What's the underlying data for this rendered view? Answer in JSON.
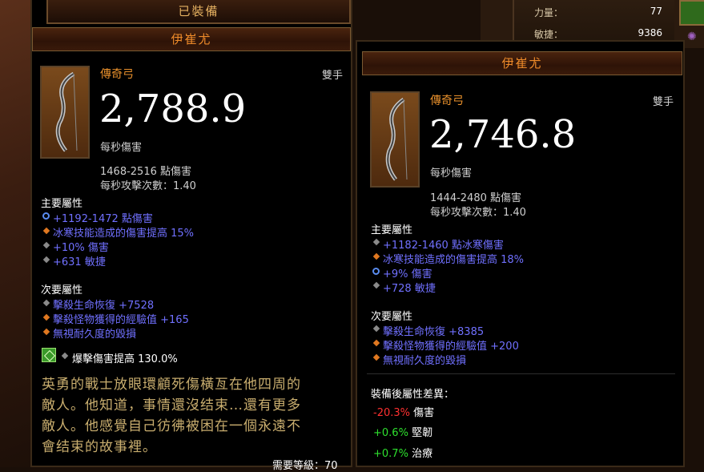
{
  "stats_panel": {
    "strength_label": "力量：",
    "strength_value": "77",
    "dexterity_label": "敏捷：",
    "dexterity_value": "9386"
  },
  "equipped_header": "已裝備",
  "left_item": {
    "name": "伊崔尤",
    "type": "傳奇弓",
    "hand": "雙手",
    "dps": "2,788.9",
    "dps_label": "每秒傷害",
    "damage_range": "1468-2516 點傷害",
    "attack_speed": "每秒攻擊次數：1.40",
    "primary_header": "主要屬性",
    "primary": [
      "+1192-1472 點傷害",
      "冰寒技能造成的傷害提高 15%",
      "+10% 傷害",
      "+631 敏捷"
    ],
    "secondary_header": "次要屬性",
    "secondary": [
      "擊殺生命恢復 +7528",
      "擊殺怪物獲得的經驗值 +165",
      "無視耐久度的毀損"
    ],
    "socket": "爆擊傷害提高 130.0%",
    "flavor": [
      "英勇的戰士放眼環顧死傷橫亙在他四周的",
      "敵人。他知道，事情還沒结束…還有更多",
      "敵人。他感覺自己彷彿被困在一個永遠不",
      "會结束的故事裡。"
    ],
    "required_level": "需要等級：70"
  },
  "right_item": {
    "name": "伊崔尤",
    "type": "傳奇弓",
    "hand": "雙手",
    "dps": "2,746.8",
    "dps_label": "每秒傷害",
    "damage_range": "1444-2480 點傷害",
    "attack_speed": "每秒攻擊次數：1.40",
    "primary_header": "主要屬性",
    "primary": [
      "+1182-1460 點冰寒傷害",
      "冰寒技能造成的傷害提高 18%",
      "+9% 傷害",
      "+728 敏捷"
    ],
    "secondary_header": "次要屬性",
    "secondary": [
      "擊殺生命恢復 +8385",
      "擊殺怪物獲得的經驗值 +200",
      "無視耐久度的毀損"
    ],
    "diff_header": "裝備後屬性差異：",
    "diffs": [
      {
        "value": "-20.3%",
        "label": "傷害",
        "color": "#ff3030"
      },
      {
        "value": "+0.6%",
        "label": "堅韌",
        "color": "#2ee02e"
      },
      {
        "value": "+0.7%",
        "label": "治療",
        "color": "#2ee02e"
      }
    ]
  }
}
